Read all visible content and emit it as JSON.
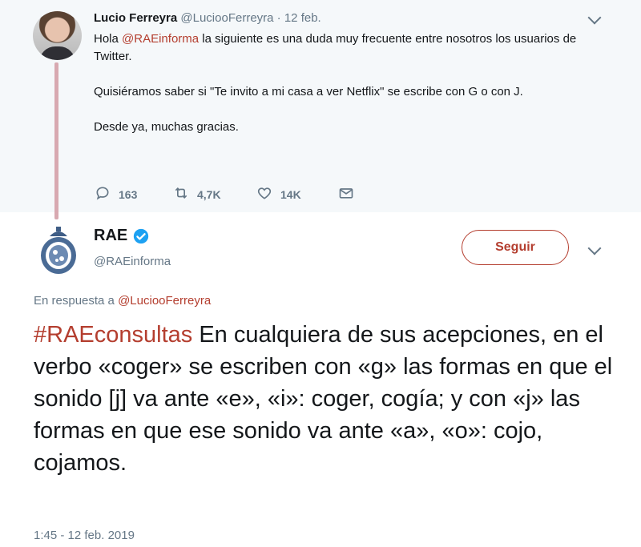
{
  "parent_tweet": {
    "author_name": "Lucio Ferreyra",
    "author_handle": "@LuciooFerreyra",
    "separator": "·",
    "date": "12 feb.",
    "text_greeting": "Hola ",
    "text_mention": "@RAEinforma",
    "text_rest": " la siguiente es una duda muy frecuente entre nosotros los usuarios de Twitter.\n\nQuisiéramos saber si \"Te invito a mi casa a ver Netflix\" se escribe con G o con J.\n\nDesde ya, muchas gracias.",
    "replies": "163",
    "retweets": "4,7K",
    "likes": "14K"
  },
  "main_tweet": {
    "author_name": "RAE",
    "author_handle": "@RAEinforma",
    "follow_label": "Seguir",
    "reply_prefix": "En respuesta a ",
    "reply_mention": "@LuciooFerreyra",
    "hashtag": "#RAEconsultas",
    "text": " En cualquiera de sus acepciones, en el verbo «coger» se escriben con «g» las formas en que el sonido [j] va ante «e», «i»: coger, cogía; y con «j» las formas en que ese sonido va ante «a», «o»: cojo, cojamos.",
    "timestamp": "1:45 - 12 feb. 2019"
  },
  "colors": {
    "accent": "#b43e2f",
    "muted": "#657786",
    "verified": "#1da1f2",
    "parent_bg": "#f5f8fa",
    "thread_line": "#d8a9b1"
  },
  "icons": [
    "reply-icon",
    "retweet-icon",
    "like-icon",
    "dm-icon",
    "verified-icon",
    "chevron-down-icon"
  ]
}
